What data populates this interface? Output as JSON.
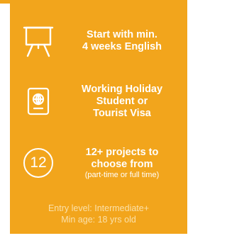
{
  "colors": {
    "card_background": "#f2a51c",
    "primary_text": "#ffffff",
    "footer_text": "#fbe0a8"
  },
  "features": [
    {
      "icon": "presentation-board-icon",
      "headline": "Start with min.\n4 weeks English"
    },
    {
      "icon": "passport-icon",
      "headline": "Working Holiday\nStudent or\nTourist Visa"
    },
    {
      "icon_text": "12",
      "headline": "12+ projects to\nchoose from",
      "subline": "(part-time or full time)"
    }
  ],
  "footer": {
    "entry_level": "Entry level: Intermediate+",
    "min_age": "Min age: 18 yrs old"
  }
}
